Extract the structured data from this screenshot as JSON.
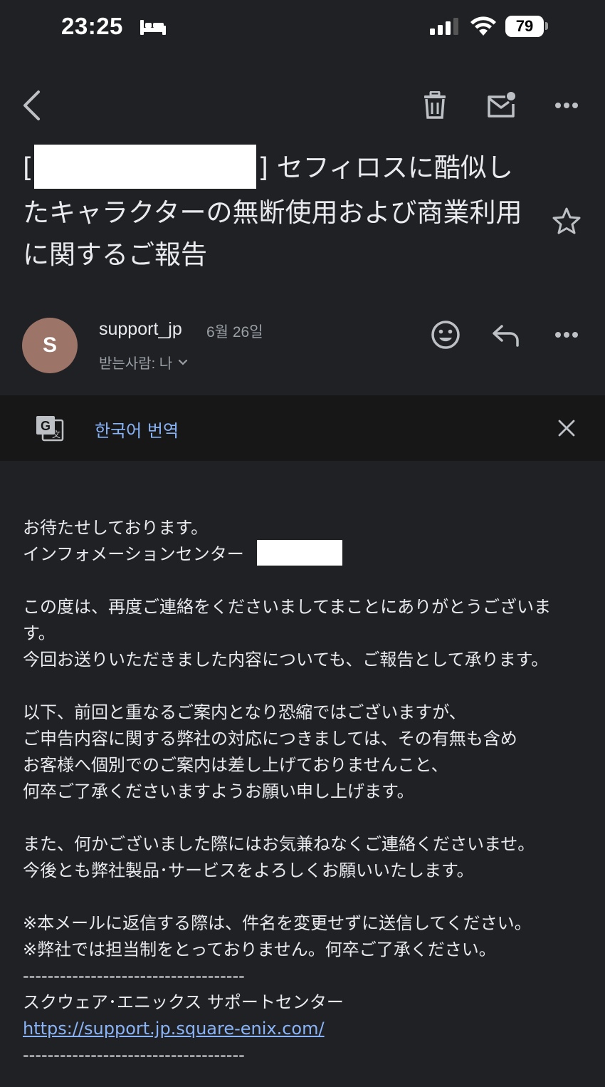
{
  "status_bar": {
    "time": "23:25",
    "battery": "79"
  },
  "toolbar": {
    "icons": [
      "back-icon",
      "trash-icon",
      "mark-unread-icon",
      "more-icon"
    ]
  },
  "email": {
    "subject_open": "[",
    "subject_rest": "] セフィロスに酷似したキャラクターの無断使用および商業利用に関するご報告",
    "sender": {
      "avatar_letter": "S",
      "name": "support_jp",
      "date": "6월 26일",
      "recipient": "받는사람: 나"
    }
  },
  "translate": {
    "label": "한국어 번역"
  },
  "body": {
    "greeting": "お待たせしております。",
    "signature_line": "インフォメーションセンター",
    "para1_line1": "この度は、再度ご連絡をくださいましてまことにありがとうございま",
    "para1_line2": "す。",
    "para1_line3": "今回お送りいただきました内容についても、ご報告として承ります。",
    "para2_line1": "以下、前回と重なるご案内となり恐縮ではございますが、",
    "para2_line2": "ご申告内容に関する弊社の対応につきましては、その有無も含め",
    "para2_line3": "お客様へ個別でのご案内は差し上げておりませんこと、",
    "para2_line4": "何卒ご了承くださいますようお願い申し上げます。",
    "para3_line1": "また、何かございました際にはお気兼ねなくご連絡くださいませ。",
    "para3_line2": "今後とも弊社製品･サービスをよろしくお願いいたします。",
    "note1": "※本メールに返信する際は、件名を変更せずに送信してください。",
    "note2": "※弊社では担当制をとっておりません。何卒ご了承ください。",
    "divider1": "------------------------------------",
    "center_name": "スクウェア･エニックス サポートセンター",
    "url": "https://support.jp.square-enix.com/",
    "divider2": "------------------------------------"
  }
}
